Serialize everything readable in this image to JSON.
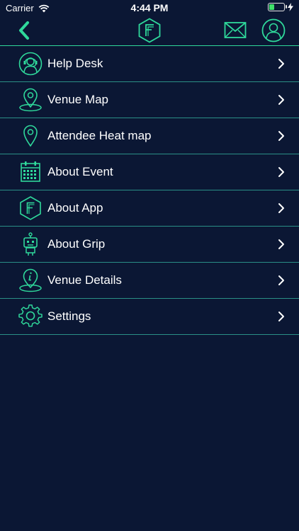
{
  "status_bar": {
    "carrier": "Carrier",
    "time": "4:44 PM",
    "battery_level": 0.35
  },
  "navbar": {
    "back_icon": "chevron-left-icon",
    "logo_icon": "hexagon-f-logo",
    "mail_icon": "envelope-icon",
    "profile_icon": "user-profile-icon"
  },
  "colors": {
    "background": "#0b1734",
    "accent": "#2fd99b",
    "divider": "#2a8f86"
  },
  "menu": {
    "items": [
      {
        "label": "Help Desk",
        "icon": "support-agent-icon"
      },
      {
        "label": "Venue Map",
        "icon": "map-pin-icon"
      },
      {
        "label": "Attendee Heat map",
        "icon": "location-pin-icon"
      },
      {
        "label": "About Event",
        "icon": "calendar-icon"
      },
      {
        "label": "About App",
        "icon": "hexagon-f-icon"
      },
      {
        "label": "About Grip",
        "icon": "robot-icon"
      },
      {
        "label": "Venue Details",
        "icon": "info-pin-icon"
      },
      {
        "label": "Settings",
        "icon": "gear-icon"
      }
    ]
  }
}
